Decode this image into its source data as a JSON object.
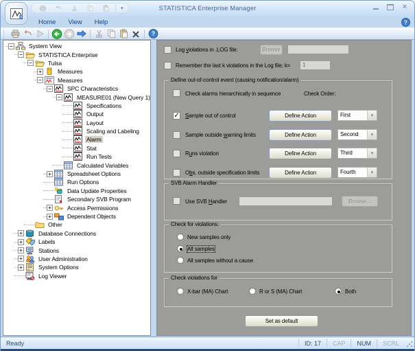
{
  "window": {
    "title": "STATISTICA Enterprise Manager"
  },
  "ribbon": {
    "tabs": [
      {
        "label": "Home"
      },
      {
        "label": "View"
      },
      {
        "label": "Help"
      }
    ]
  },
  "qat": {
    "icons": [
      "print",
      "undo",
      "cut",
      "copy",
      "paste"
    ],
    "caret": "▾"
  },
  "toolbar": {
    "icons": [
      "print",
      "undo",
      "run",
      "sep",
      "back",
      "forward",
      "go",
      "sep",
      "cut",
      "copy",
      "paste",
      "delete",
      "sep",
      "help"
    ]
  },
  "tree": {
    "items": [
      {
        "label": "System View",
        "level": 0,
        "exp": "minus",
        "icon": "system-view"
      },
      {
        "label": "STATISTICA Enterprise",
        "level": 1,
        "exp": "minus",
        "icon": "folder-open"
      },
      {
        "label": "Tulsa",
        "level": 2,
        "exp": "minus",
        "icon": "folder-open"
      },
      {
        "label": "Measures",
        "level": 3,
        "exp": "plus",
        "icon": "measures-db"
      },
      {
        "label": "Measures",
        "level": 3,
        "exp": "minus",
        "icon": "measures-chart"
      },
      {
        "label": "SPC Characteristics",
        "level": 4,
        "exp": "minus",
        "icon": "chart"
      },
      {
        "label": "MEASURE01 (New Query 1)",
        "level": 5,
        "exp": "minus",
        "icon": "chart"
      },
      {
        "label": "Specifications",
        "level": 6,
        "icon": "chart"
      },
      {
        "label": "Output",
        "level": 6,
        "icon": "chart"
      },
      {
        "label": "Layout",
        "level": 6,
        "icon": "chart"
      },
      {
        "label": "Scaling and Labeling",
        "level": 6,
        "icon": "chart"
      },
      {
        "label": "Alarm",
        "level": 6,
        "icon": "chart",
        "selected": true
      },
      {
        "label": "Stat",
        "level": 6,
        "icon": "chart"
      },
      {
        "label": "Run Tests",
        "level": 6,
        "icon": "chart"
      },
      {
        "label": "Calculated Variables",
        "level": 5,
        "icon": "table"
      },
      {
        "label": "Spreadsheet Options",
        "level": 4,
        "exp": "plus",
        "icon": "table"
      },
      {
        "label": "Run Options",
        "level": 4,
        "icon": "table"
      },
      {
        "label": "Data Update Properties",
        "level": 4,
        "icon": "data-update"
      },
      {
        "label": "Secondary SVB Program",
        "level": 4,
        "icon": "svb-program"
      },
      {
        "label": "Access Permissions",
        "level": 4,
        "exp": "plus",
        "icon": "key"
      },
      {
        "label": "Dependent Objects",
        "level": 4,
        "exp": "plus",
        "icon": "dependent"
      },
      {
        "label": "Other",
        "level": 2,
        "icon": "folder-closed"
      },
      {
        "label": "Database Connections",
        "level": 1,
        "exp": "plus",
        "icon": "database"
      },
      {
        "label": "Labels",
        "level": 1,
        "exp": "plus",
        "icon": "labels"
      },
      {
        "label": "Stations",
        "level": 1,
        "exp": "plus",
        "icon": "station"
      },
      {
        "label": "User Administration",
        "level": 1,
        "exp": "plus",
        "icon": "users"
      },
      {
        "label": "System Options",
        "level": 1,
        "exp": "plus",
        "icon": "system"
      },
      {
        "label": "Log Viewer",
        "level": 1,
        "icon": "log"
      }
    ]
  },
  "panel": {
    "log_violations": {
      "label": "Log violations in .LOG file:",
      "accel": "v",
      "checked": false,
      "browse_label": "Browse",
      "field_value": ""
    },
    "remember_k": {
      "label": "Remember the last k violations in the Log file; k=",
      "checked": false,
      "field_value": "1"
    },
    "out_of_control": {
      "title": "Define out-of-control event (causing notification/alarm)",
      "hierarchical": {
        "label": "Check alarms hierarchically in sequence",
        "checked": false
      },
      "check_order_label": "Check Order:",
      "rows": [
        {
          "label": "Sample out of control",
          "accel": "S",
          "checked": true,
          "button": "Define Action",
          "order": "First"
        },
        {
          "label": "Sample outside warning limits",
          "accel": "w",
          "checked": false,
          "button": "Define Action",
          "order": "Second"
        },
        {
          "label": "Runs violation",
          "accel": "u",
          "checked": false,
          "button": "Define Action",
          "order": "Third"
        },
        {
          "label": "Obs. outside specification limits",
          "accel": "b",
          "checked": false,
          "button": "Define Action",
          "order": "Fourth"
        }
      ]
    },
    "svb": {
      "title": "SVB Alarm Handler",
      "label": "Use SVB Handler",
      "accel": "H",
      "checked": false,
      "field_value": "",
      "browse_label": "Browse..."
    },
    "check_for_violations": {
      "title": "Check for violations:",
      "options": [
        "New samples only",
        "All samples",
        "All samples without a cause"
      ],
      "selected": "All samples"
    },
    "check_violations_for": {
      "title": "Check violations for",
      "options": [
        "X-bar (MA) Chart",
        "R or S (MA) Chart",
        "Both"
      ],
      "selected": "Both"
    },
    "set_default_label": "Set as default"
  },
  "statusbar": {
    "ready": "Ready",
    "indicators": [
      {
        "label": "ID: 17",
        "active": true
      },
      {
        "label": "CAP",
        "active": false
      },
      {
        "label": "NUM",
        "active": true
      },
      {
        "label": "SCRL",
        "active": false
      }
    ]
  }
}
